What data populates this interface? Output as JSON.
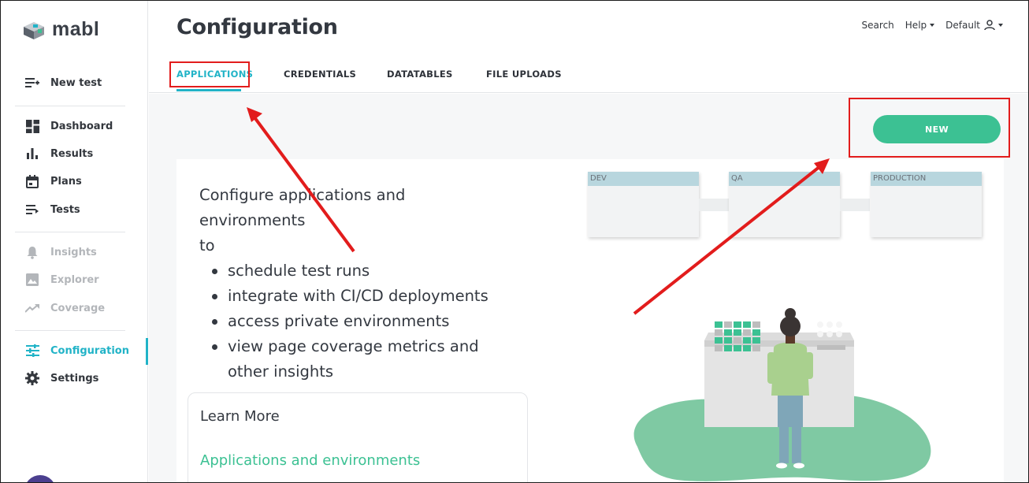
{
  "app": {
    "logo_text": "mabl"
  },
  "sidebar": {
    "new_test": "New test",
    "items_main": [
      {
        "label": "Dashboard",
        "icon": "dashboard-icon"
      },
      {
        "label": "Results",
        "icon": "bar-chart-icon"
      },
      {
        "label": "Plans",
        "icon": "calendar-icon"
      },
      {
        "label": "Tests",
        "icon": "list-icon"
      }
    ],
    "items_disabled": [
      {
        "label": "Insights",
        "icon": "bell-icon"
      },
      {
        "label": "Explorer",
        "icon": "image-icon"
      },
      {
        "label": "Coverage",
        "icon": "trending-icon"
      }
    ],
    "configuration": "Configuration",
    "settings": "Settings"
  },
  "header": {
    "title": "Configuration",
    "search": "Search",
    "help": "Help",
    "workspace": "Default"
  },
  "tabs": {
    "applications": "APPLICATIONS",
    "credentials": "CREDENTIALS",
    "datatables": "DATATABLES",
    "file_uploads": "FILE UPLOADS",
    "active": "APPLICATIONS"
  },
  "main": {
    "new_button": "NEW",
    "intro_line1": "Configure applications and environments",
    "intro_line2": "to",
    "bullets": [
      "schedule test runs",
      "integrate with CI/CD deployments",
      "access private environments",
      "view page coverage metrics and other insights"
    ],
    "learn_more_title": "Learn More",
    "learn_more_link": "Applications and environments",
    "environments": [
      "DEV",
      "QA",
      "PRODUCTION"
    ]
  },
  "colors": {
    "accent": "#21b3c7",
    "primary_button": "#3cc193",
    "annotation": "#e21c1c"
  }
}
